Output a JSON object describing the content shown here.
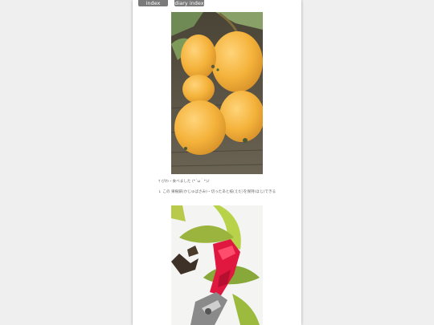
{
  "nav": {
    "index_label": "index",
    "diary_index_label": "diary index"
  },
  "entries": [
    {
      "caption": "† びわ・食べました (*´ω｀*)♪"
    },
    {
      "caption": "↓ この 果樹鋏(かじゅばさみ)・切ったあと枝(えだ)を保持(ほじ)できる"
    }
  ],
  "photos": [
    {
      "alt": "loquat fruits"
    },
    {
      "alt": "pruning shears"
    }
  ],
  "colors": {
    "background": "#efefef",
    "page": "#ffffff",
    "nav_button": "#7a7a7a",
    "loquat": "#f4b23a",
    "shears_red": "#e0173f"
  }
}
